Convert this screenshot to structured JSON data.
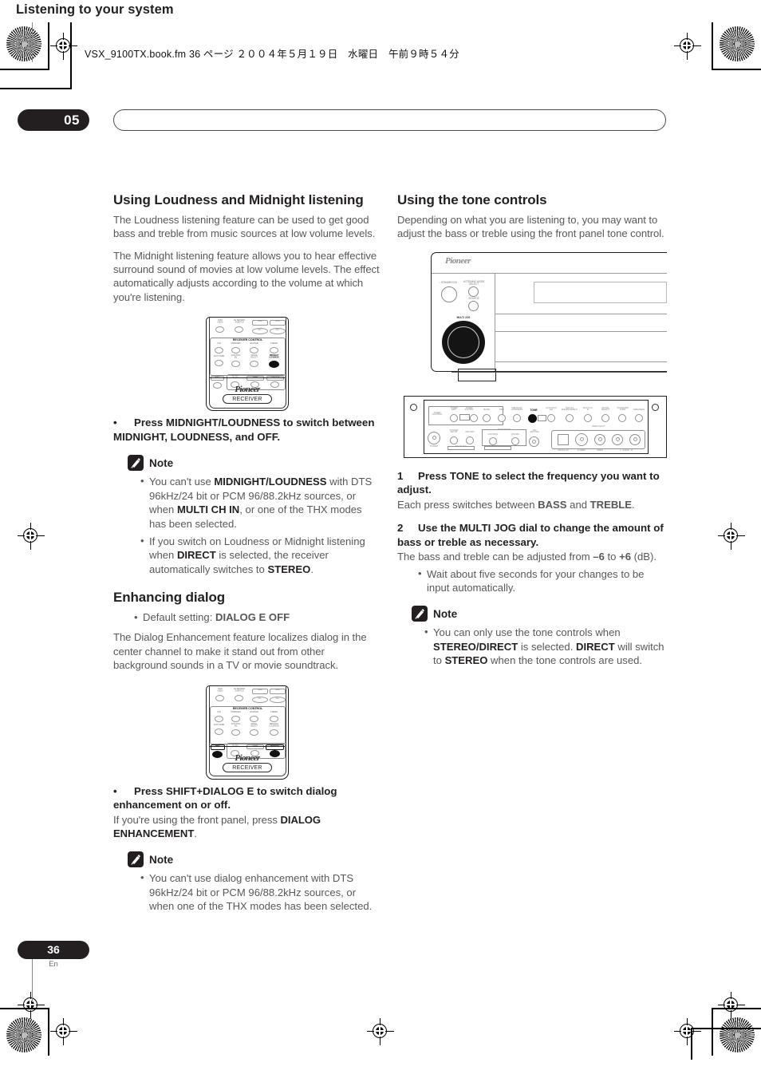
{
  "document": {
    "file_info": "VSX_9100TX.book.fm 36 ページ ２００４年５月１９日　水曜日　午前９時５４分",
    "chapter_number": "05",
    "chapter_title": "Listening to your system",
    "page_number": "36",
    "page_language": "En"
  },
  "left_column": {
    "heading": "Using Loudness and Midnight listening",
    "para1": "The Loudness listening feature can be used to get good bass and treble from music sources at low volume levels.",
    "para2": "The Midnight listening feature allows you to hear effective surround sound of movies at low volume levels. The effect automatically adjusts according to the volume at which you're listening.",
    "instruction_bullet": "•",
    "instruction": "Press MIDNIGHT/LOUDNESS to switch between MIDNIGHT, LOUDNESS, and OFF.",
    "note_label": "Note",
    "note_items": [
      "You can't use MIDNIGHT/LOUDNESS with DTS 96kHz/24 bit or PCM 96/88.2kHz sources, or when MULTI CH IN, or one of the THX modes has been selected.",
      "If you switch on Loudness or Midnight listening when DIRECT is selected, the receiver automatically switches to STEREO."
    ],
    "heading2": "Enhancing dialog",
    "default_setting": "Default setting: DIALOG E OFF",
    "para3": "The Dialog Enhancement feature localizes dialog in the center channel to make it stand out from other background sounds in a TV or movie soundtrack.",
    "instruction2": "Press SHIFT+DIALOG E to switch dialog enhancement on or off.",
    "instruction2_sub": "If you're using the front panel, press DIALOG ENHANCEMENT.",
    "note2_label": "Note",
    "note2_items": [
      "You can't use dialog enhancement with DTS 96kHz/24 bit or PCM 96/88.2kHz sources, or when one of the THX modes has been selected."
    ]
  },
  "right_column": {
    "heading": "Using the tone controls",
    "para1": "Depending on what you are listening to, you may want to adjust the bass or treble using the front panel tone control.",
    "steps": [
      {
        "number": "1",
        "title": "Press TONE to select the frequency you want to adjust.",
        "body": "Each press switches between BASS and TREBLE."
      },
      {
        "number": "2",
        "title": "Use the MULTI JOG dial to change the amount of bass or treble as necessary.",
        "body": "The bass and treble can be adjusted from –6 to +6 (dB).",
        "sub_bullets": [
          "Wait about five seconds for your changes to be input automatically."
        ]
      }
    ],
    "note_label": "Note",
    "note_items": [
      "You can only use the tone controls when STEREO/DIRECT is selected. DIRECT will switch to STEREO when the tone controls are used."
    ]
  },
  "remote_figure_1": {
    "brand": "Pioneer",
    "mode_tag": "RECEIVER",
    "section_title": "RECEIVER CONTROL",
    "top_labels": [
      "DVD/\nAUDIO",
      "CH SET/DISC\nSUBTITLE",
      "HDD",
      "DVD",
      "CH –",
      "CH +"
    ],
    "buttons": [
      "THX",
      "STANDARD",
      "ADVANCE",
      "STEREO",
      "AUTO SURR",
      "ACOUSTIC\nEQ",
      "SIGNAL\nSELECT",
      "MIDNIGHT\nLOUDNESS",
      "SHIFT",
      "EFFECT\nCH SEL",
      "SLEEP",
      "DIALOG E"
    ],
    "highlighted_button": "MIDNIGHT LOUDNESS"
  },
  "remote_figure_2": {
    "brand": "Pioneer",
    "mode_tag": "RECEIVER",
    "section_title": "RECEIVER CONTROL",
    "top_labels": [
      "DVD/\nAUDIO",
      "CH SET/DISC\nSUBTITLE",
      "HDD",
      "DVD",
      "CH –",
      "CH +"
    ],
    "buttons": [
      "THX",
      "STANDARD",
      "ADVANCE",
      "STEREO",
      "AUTO SURR",
      "ACOUSTIC\nEQ",
      "SIGNAL\nSELECT",
      "MIDNIGHT\nLOUDNESS",
      "SHIFT",
      "EFFECT\nCH SEL",
      "SLEEP",
      "DIALOG E"
    ],
    "highlighted_buttons": [
      "SHIFT",
      "DIALOG E"
    ]
  },
  "front_panel_figure": {
    "brand": "Pioneer",
    "labels": [
      "STANDBY/ON",
      "LISTENING MODE\nSELECT",
      "SOURCE",
      "MULTI JOG"
    ]
  },
  "panel_strip_figure": {
    "labels_row1": [
      "TUNER\nCONTROL",
      "TUNER\nEDIT",
      "TUNER\nSTATION",
      "BAND",
      "MPX",
      "MIDNIGHT\nLOUDNESS",
      "TONE",
      "ACOUSTIC\nEQ",
      "DIALOG\nENHANCEMENT",
      "MULTI CH\nIN",
      "SIGNAL\nSELECT",
      "STANDARD\nSURR",
      "SPEAKERS"
    ],
    "labels_row2": [
      "POWER",
      "SYSTEM\nSETUP",
      "RETURN",
      "MULTI ROOM\nCONTROL",
      "ON/OFF",
      "MULTI JOG",
      "MULTI JOG",
      "MIC\nSETTING",
      "VIDEO INPUT"
    ],
    "labels_jacks": [
      "DIGITAL IN",
      "S-VIDEO",
      "VIDEO",
      "L - AUDIO - R"
    ],
    "highlighted_button": "TONE"
  }
}
